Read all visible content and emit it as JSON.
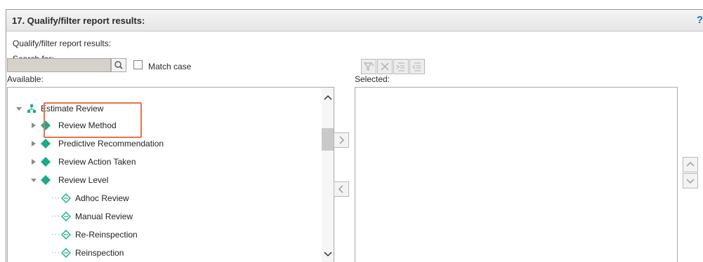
{
  "header": {
    "title": "17. Qualify/filter report results:"
  },
  "section": {
    "label": "Qualify/filter report results:"
  },
  "search": {
    "label": "Search for:",
    "value": "",
    "placeholder": ""
  },
  "match_case": {
    "label": "Match case",
    "checked": false
  },
  "lists": {
    "available_label": "Available:",
    "selected_label": "Selected:"
  },
  "tree": {
    "root": "Estimate Review",
    "children": [
      {
        "label": "Review Method",
        "expanded": false
      },
      {
        "label": "Predictive Recommendation",
        "expanded": false
      },
      {
        "label": "Review Action Taken",
        "expanded": false
      },
      {
        "label": "Review Level",
        "expanded": true
      }
    ],
    "review_level_values": [
      "Adhoc Review",
      "Manual Review",
      "Re-Reinspection",
      "Reinspection"
    ]
  },
  "colors": {
    "accent": "#1aa98a",
    "highlight": "#e8734f",
    "header_text": "#2b2b2b"
  },
  "icons": {
    "tree_root": "hierarchy-icon",
    "field": "diamond-icon",
    "value": "value-diamond-icon",
    "search": "search-icon"
  }
}
